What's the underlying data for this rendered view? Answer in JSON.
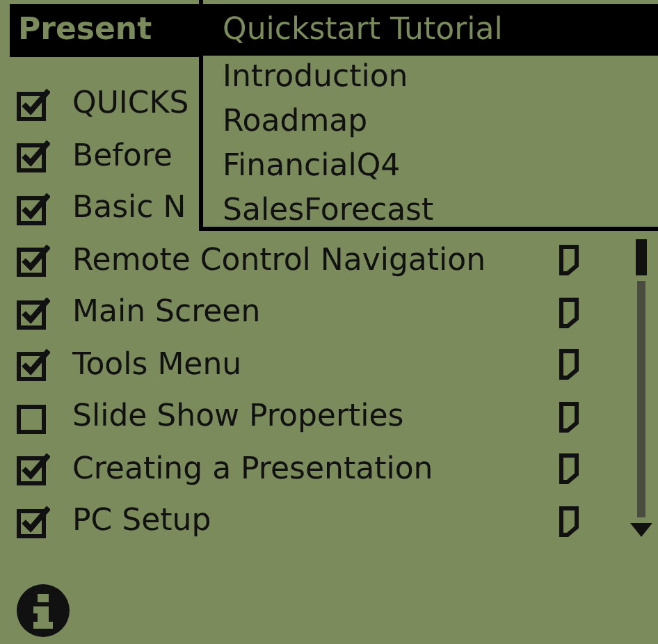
{
  "title": "Present",
  "menu": {
    "items": [
      {
        "label": "Quickstart Tutorial",
        "selected": true
      },
      {
        "label": "Introduction",
        "selected": false
      },
      {
        "label": "Roadmap",
        "selected": false
      },
      {
        "label": "FinancialQ4",
        "selected": false
      },
      {
        "label": "SalesForecast",
        "selected": false
      }
    ]
  },
  "topics": [
    {
      "label": "QUICKS",
      "checked": true
    },
    {
      "label": "Before",
      "checked": true
    },
    {
      "label": "Basic N",
      "checked": true
    },
    {
      "label": "Remote Control Navigation",
      "checked": true,
      "note": true
    },
    {
      "label": "Main Screen",
      "checked": true,
      "note": true
    },
    {
      "label": "Tools Menu",
      "checked": true,
      "note": true
    },
    {
      "label": "Slide Show Properties",
      "checked": false,
      "note": true
    },
    {
      "label": "Creating a Presentation",
      "checked": true,
      "note": true
    },
    {
      "label": "PC Setup",
      "checked": true,
      "note": true
    }
  ]
}
